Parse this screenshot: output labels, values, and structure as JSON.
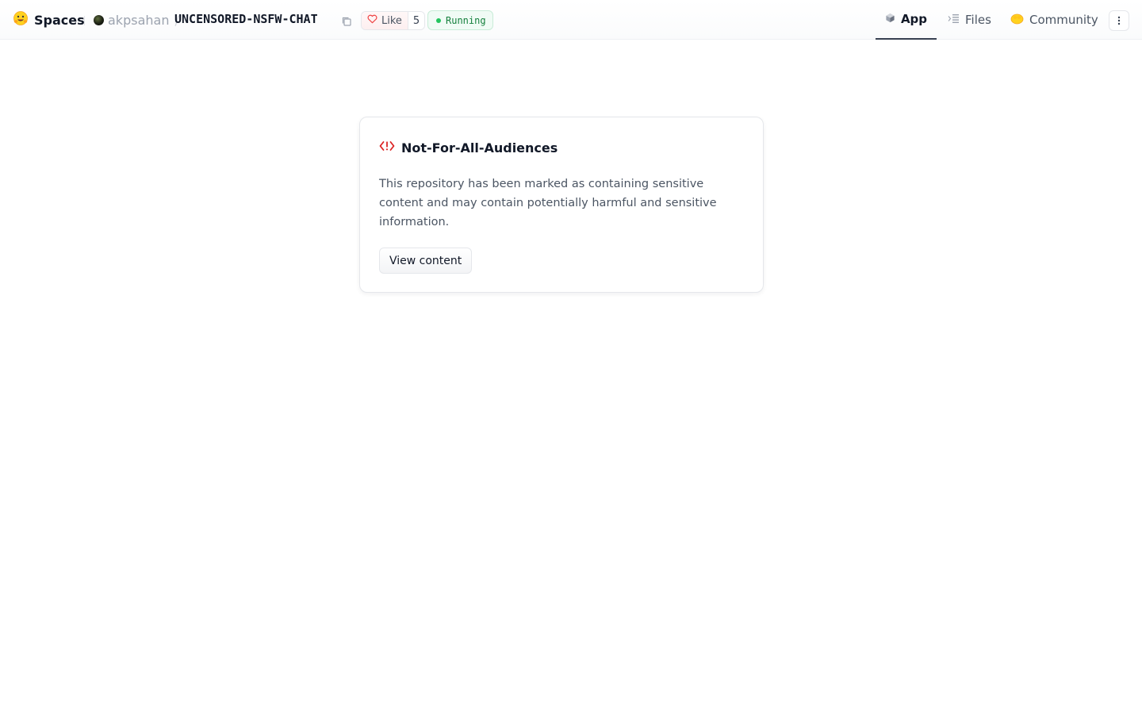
{
  "header": {
    "brand": {
      "label": "Spaces",
      "icon": "hugging-face-logo"
    },
    "owner": {
      "name": "akpsahan",
      "separator": "/"
    },
    "repo_name": "UNCENSORED-NSFW-CHAT",
    "like": {
      "label": "Like",
      "count": "5"
    },
    "status": {
      "label": "Running",
      "color": "#22c55e"
    },
    "tabs": [
      {
        "label": "App",
        "icon": "app-cube-icon",
        "active": true
      },
      {
        "label": "Files",
        "icon": "files-icon",
        "active": false
      },
      {
        "label": "Community",
        "icon": "community-icon",
        "active": false
      }
    ]
  },
  "notice": {
    "title": "Not-For-All-Audiences",
    "icon": "warning-code-icon",
    "accent": "#dc2626",
    "text": "This repository has been marked as containing sensitive content and may contain potentially harmful and sensitive information.",
    "button_label": "View content"
  }
}
